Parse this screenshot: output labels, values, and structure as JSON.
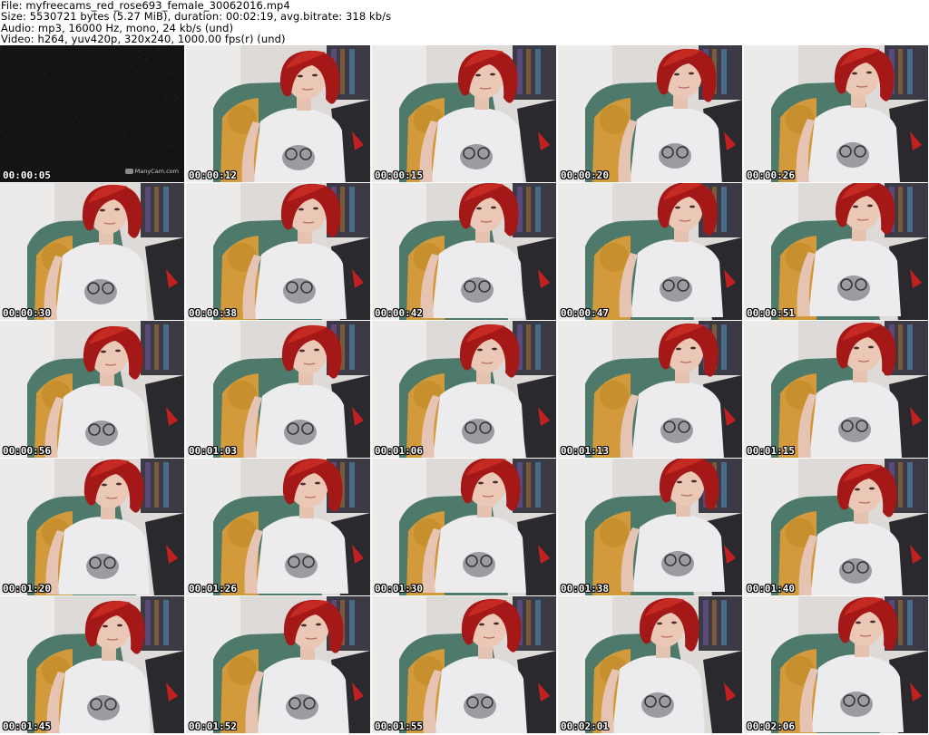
{
  "header": {
    "file": "File: myfreecams_red_rose693_female_30062016.mp4",
    "size": "Size: 5530721 bytes (5.27 MiB), duration: 00:02:19, avg.bitrate: 318 kb/s",
    "audio": "Audio: mp3, 16000 Hz, mono, 24 kb/s (und)",
    "video": "Video: h264, yuv420p, 320x240, 1000.00 fps(r) (und)"
  },
  "watermark": "ManyCam.com",
  "frames": [
    {
      "time": "00:00:05",
      "kind": "dark"
    },
    {
      "time": "00:00:12",
      "kind": "person"
    },
    {
      "time": "00:00:15",
      "kind": "person"
    },
    {
      "time": "00:00:20",
      "kind": "person"
    },
    {
      "time": "00:00:26",
      "kind": "person"
    },
    {
      "time": "00:00:30",
      "kind": "person"
    },
    {
      "time": "00:00:38",
      "kind": "person"
    },
    {
      "time": "00:00:42",
      "kind": "person"
    },
    {
      "time": "00:00:47",
      "kind": "person"
    },
    {
      "time": "00:00:51",
      "kind": "person"
    },
    {
      "time": "00:00:56",
      "kind": "person"
    },
    {
      "time": "00:01:03",
      "kind": "person"
    },
    {
      "time": "00:01:06",
      "kind": "person"
    },
    {
      "time": "00:01:13",
      "kind": "person"
    },
    {
      "time": "00:01:15",
      "kind": "person"
    },
    {
      "time": "00:01:20",
      "kind": "person"
    },
    {
      "time": "00:01:26",
      "kind": "person"
    },
    {
      "time": "00:01:30",
      "kind": "person"
    },
    {
      "time": "00:01:38",
      "kind": "person"
    },
    {
      "time": "00:01:40",
      "kind": "person"
    },
    {
      "time": "00:01:45",
      "kind": "person"
    },
    {
      "time": "00:01:52",
      "kind": "person"
    },
    {
      "time": "00:01:55",
      "kind": "person"
    },
    {
      "time": "00:02:01",
      "kind": "person"
    },
    {
      "time": "00:02:06",
      "kind": "person"
    }
  ]
}
